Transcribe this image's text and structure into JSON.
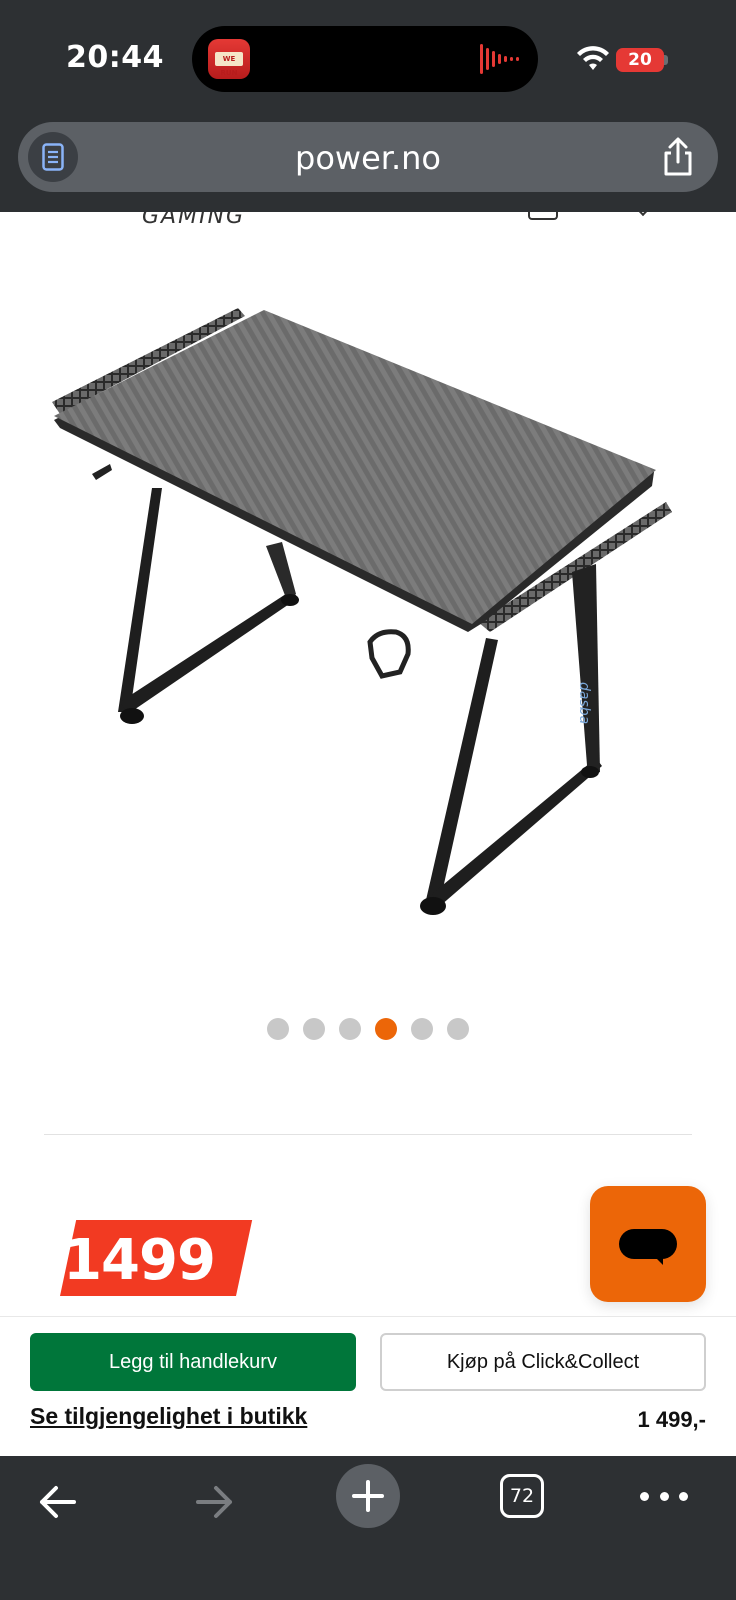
{
  "status_bar": {
    "time": "20:44",
    "live_activity_text": "WE RUN",
    "battery": "20"
  },
  "browser": {
    "url": "power.no",
    "reader_icon": "reader-mode-icon",
    "share_icon": "share-icon"
  },
  "page": {
    "brand_text": "GAMING",
    "image_alt": "Gaming desk with carbon fiber top",
    "carousel": {
      "total": 6,
      "active_index": 3
    },
    "price_badge": "1499",
    "chat_icon": "chat-bubble-icon",
    "colors": {
      "accent": "#ec6608",
      "price_red": "#f23a22",
      "cart_green": "#00763a"
    }
  },
  "sticky_bar": {
    "add_to_cart_label": "Legg til handlekurv",
    "click_collect_label": "Kjøp på Click&Collect",
    "availability_link": "Se tilgjengelighet i butikk",
    "price": "1 499,-"
  },
  "toolbar": {
    "tab_count": "72",
    "back_icon": "arrow-left-icon",
    "forward_icon": "arrow-right-icon",
    "new_tab_icon": "plus-icon",
    "more_icon": "more-dots-icon"
  }
}
